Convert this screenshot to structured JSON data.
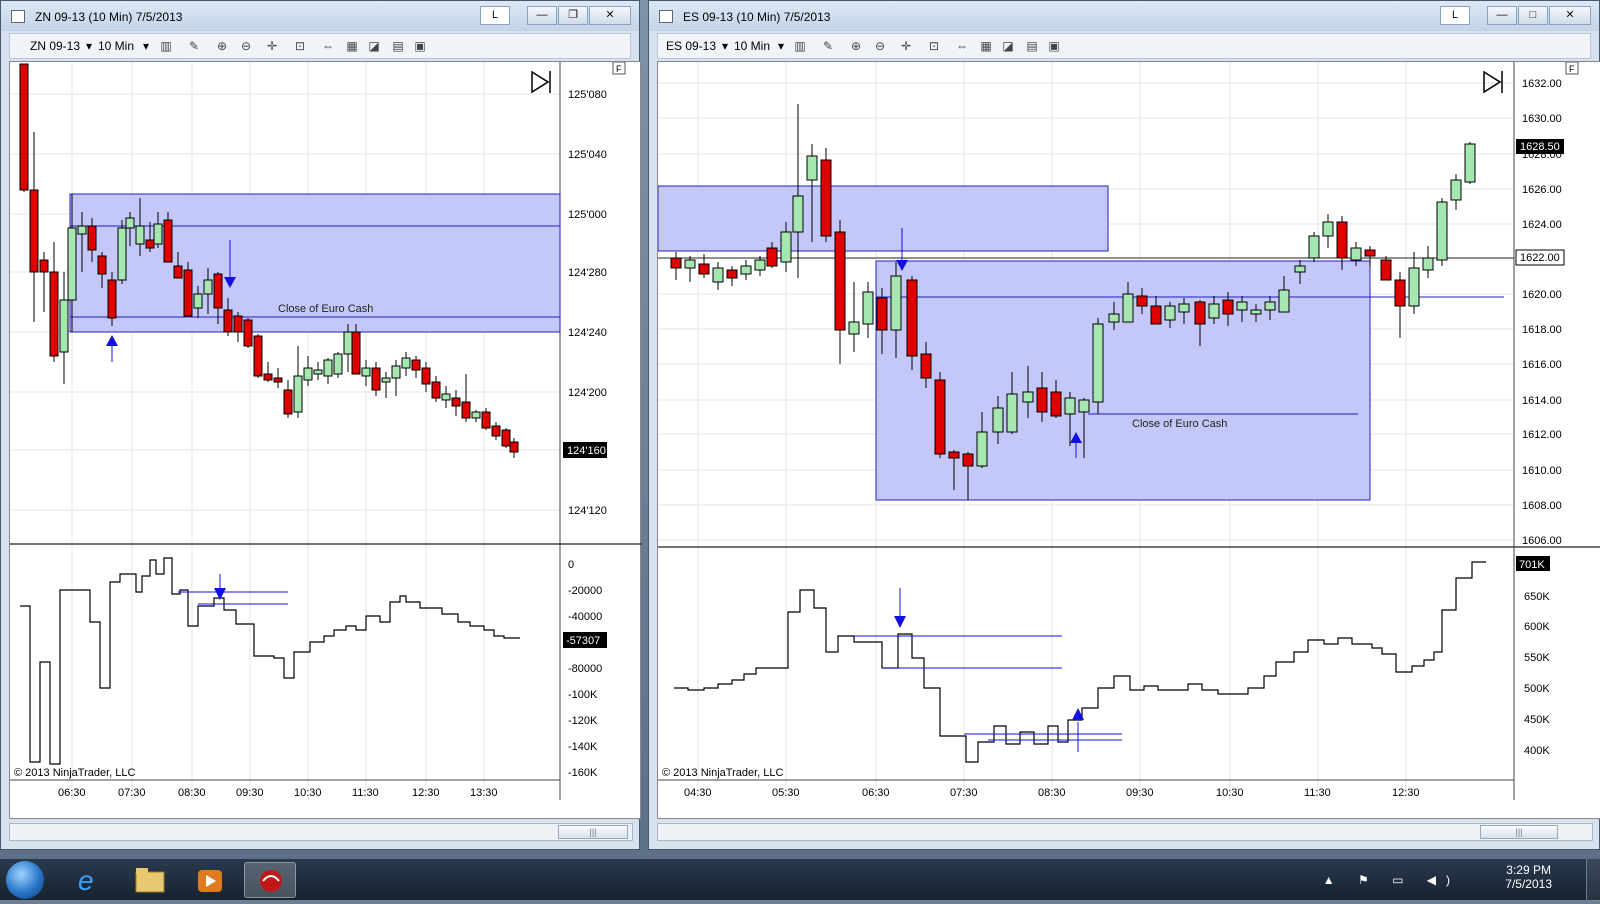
{
  "left_window": {
    "title": "ZN 09-13 (10 Min)  7/5/2013",
    "instrument": "ZN 09-13",
    "interval": "10 Min",
    "l_button": "L",
    "copyright": "© 2013 NinjaTrader, LLC",
    "zone_label": "Close of Euro Cash",
    "price_ticks": [
      "125'080",
      "125'040",
      "125'000",
      "124'280",
      "124'240",
      "124'200",
      "124'160",
      "124'120"
    ],
    "last_price": "124'160",
    "indicator_ticks": [
      "0",
      "-20000",
      "-40000",
      "-57307",
      "-80000",
      "-100K",
      "-120K",
      "-140K",
      "-160K"
    ],
    "indicator_last": "-57307",
    "time_ticks": [
      "06:30",
      "07:30",
      "08:30",
      "09:30",
      "10:30",
      "11:30",
      "12:30",
      "13:30"
    ],
    "f_marker": "F"
  },
  "right_window": {
    "title": "ES 09-13 (10 Min)  7/5/2013",
    "instrument": "ES 09-13",
    "interval": "10 Min",
    "l_button": "L",
    "copyright": "© 2013 NinjaTrader, LLC",
    "zone_label": "Close of Euro Cash",
    "price_ticks": [
      "1632.00",
      "1630.00",
      "1628.00",
      "1626.00",
      "1624.00",
      "1622.00",
      "1620.00",
      "1618.00",
      "1616.00",
      "1614.00",
      "1612.00",
      "1610.00",
      "1608.00",
      "1606.00"
    ],
    "last_price": "1628.50",
    "ref_price": "1622.00",
    "indicator_ticks": [
      "650K",
      "600K",
      "550K",
      "500K",
      "450K",
      "400K"
    ],
    "indicator_last": "701K",
    "time_ticks": [
      "04:30",
      "05:30",
      "06:30",
      "07:30",
      "08:30",
      "09:30",
      "10:30",
      "11:30",
      "12:30"
    ],
    "f_marker": "F"
  },
  "taskbar": {
    "time": "3:29 PM",
    "date": "7/5/2013",
    "apps": [
      "start-button",
      "internet-explorer",
      "windows-explorer",
      "media-player",
      "ninjatrader"
    ]
  },
  "colors": {
    "bull_candle": "#a6e6b0",
    "bear_candle": "#e00000",
    "zone_fill": "#c4c8f8",
    "zone_border": "#2020c0",
    "arrow": "#1010e0"
  }
}
